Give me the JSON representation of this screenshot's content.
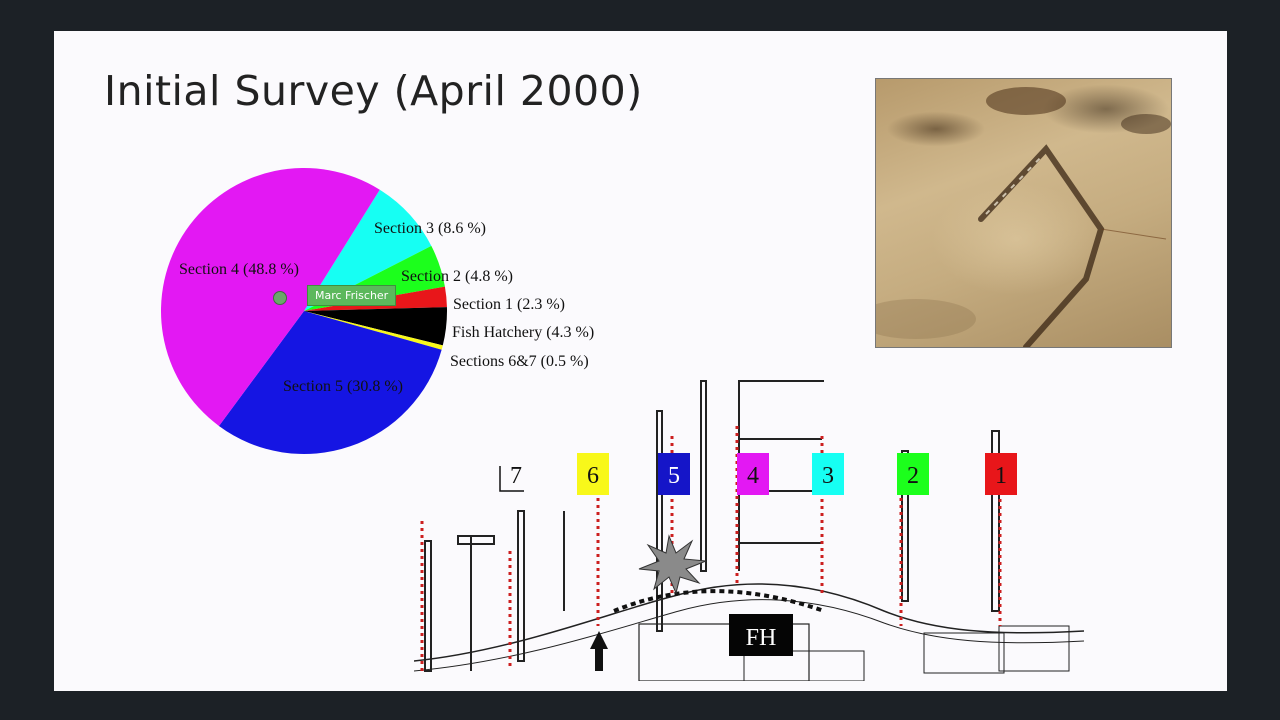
{
  "slide": {
    "title": "Initial Survey (April 2000)"
  },
  "presenter_badge": "Marc Frischer",
  "photo": {
    "name": "seabed-photo"
  },
  "colors": {
    "section1": "#e8161a",
    "section2": "#1cff1c",
    "section3": "#16fff3",
    "section4": "#e318f3",
    "section5": "#1515e3",
    "sections67": "#f8f81a",
    "fish_hatchery": "#000000",
    "marker_red": "#cc1f1f"
  },
  "chart_data": {
    "type": "pie",
    "slices": [
      {
        "label": "Section 3 (8.6 %)",
        "value": 8.6,
        "color": "#16fff3"
      },
      {
        "label": "Section 2 (4.8 %)",
        "value": 4.8,
        "color": "#1cff1c"
      },
      {
        "label": "Section 1 (2.3 %)",
        "value": 2.3,
        "color": "#e8161a"
      },
      {
        "label": "Fish Hatchery (4.3 %)",
        "value": 4.3,
        "color": "#000000"
      },
      {
        "label": "Sections 6&7 (0.5 %)",
        "value": 0.5,
        "color": "#f8f81a"
      },
      {
        "label": "Section 5 (30.8 %)",
        "value": 30.8,
        "color": "#1515e3"
      },
      {
        "label": "Section 4 (48.8 %)",
        "value": 48.8,
        "color": "#e318f3"
      }
    ]
  },
  "site_map": {
    "sections": [
      {
        "label": "7",
        "bg": "#fbfafd",
        "fg": "#111111"
      },
      {
        "label": "6",
        "bg": "#f8f81a",
        "fg": "#111111"
      },
      {
        "label": "5",
        "bg": "#1515c8",
        "fg": "#ffffff"
      },
      {
        "label": "4",
        "bg": "#e318f3",
        "fg": "#111111"
      },
      {
        "label": "3",
        "bg": "#16fff3",
        "fg": "#111111"
      },
      {
        "label": "2",
        "bg": "#1cff1c",
        "fg": "#111111"
      },
      {
        "label": "1",
        "bg": "#e8161a",
        "fg": "#111111"
      }
    ],
    "fh_label": "FH"
  }
}
